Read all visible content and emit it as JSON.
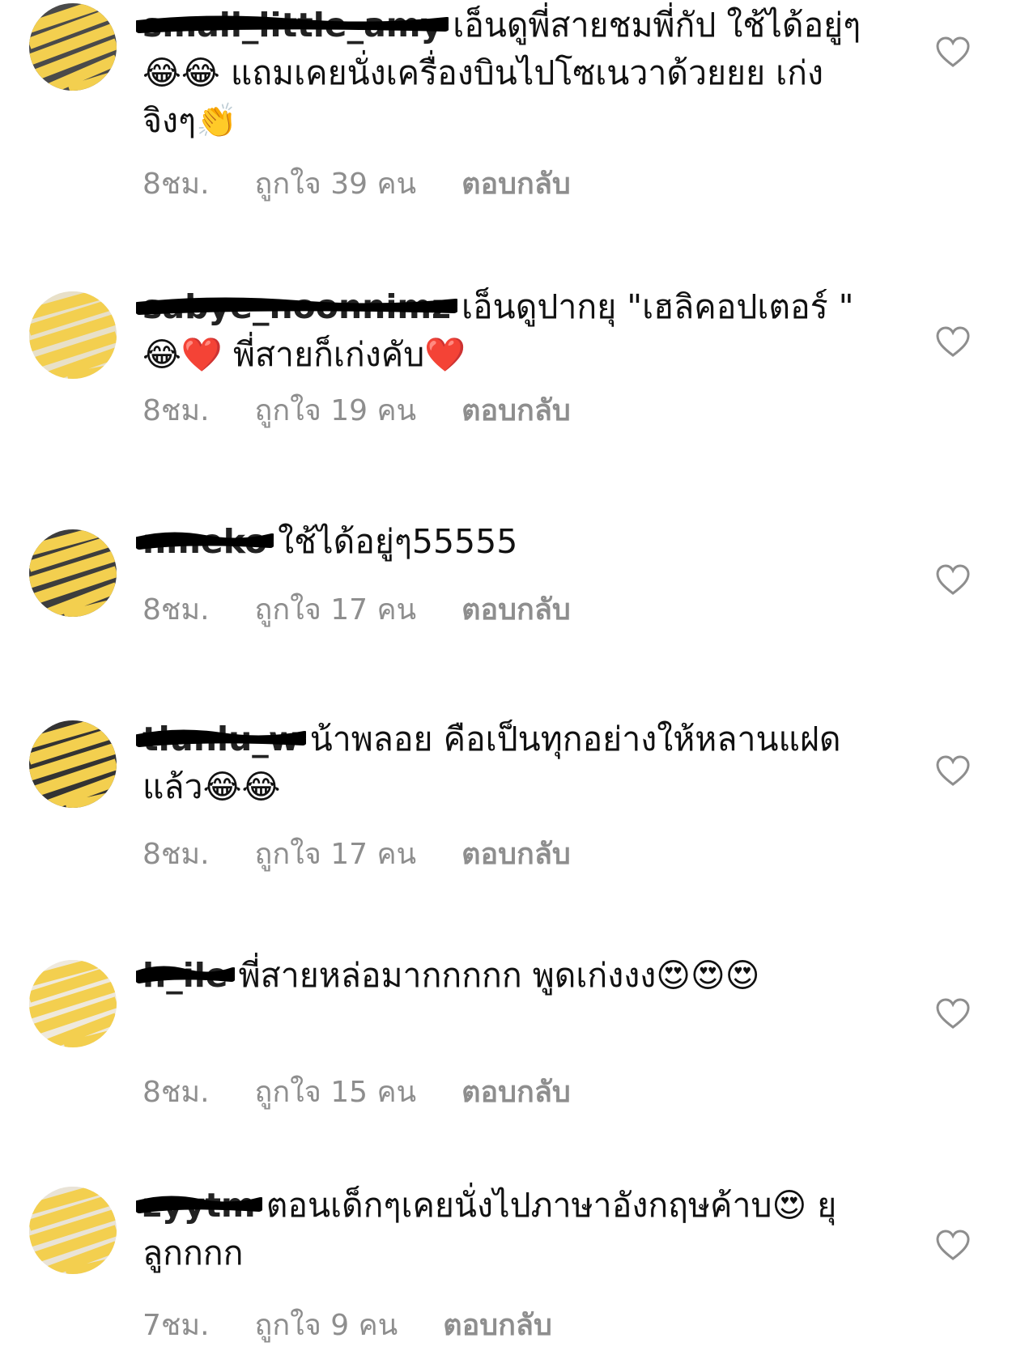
{
  "comments": [
    {
      "username": "small_little_amy",
      "text": "เอ็นดูพี่สายชมพี่กัป ใช้ได้อยู่ๆ 😂😂 แถมเคยนั่งเครื่องบินไปโซเนวาด้วยยย เก่งจิงๆ👏",
      "time": "8ชม.",
      "likes": "ถูกใจ 39 คน",
      "reply": "ตอบกลับ"
    },
    {
      "username": "sabye_noonnimz",
      "text": "เอ็นดูปากยุ \"เฮลิคอปเตอร์ \" 😂❤️ พี่สายก็เก่งคับ❤️",
      "time": "8ชม.",
      "likes": "ถูกใจ 19 คน",
      "reply": "ตอบกลับ"
    },
    {
      "username": "nmeko",
      "text": "ใช้ได้อยู่ๆ55555",
      "time": "8ชม.",
      "likes": "ถูกใจ 17 คน",
      "reply": "ตอบกลับ"
    },
    {
      "username": "tlunlu_w",
      "text": "น้าพลอย คือเป็นทุกอย่างให้หลานแฝดแล้ว😂😂",
      "time": "8ชม.",
      "likes": "ถูกใจ 17 คน",
      "reply": "ตอบกลับ"
    },
    {
      "username": "h_ile",
      "text": "พี่สายหล่อมากกกกก พูดเก่งงง😍😍😍",
      "time": "8ชม.",
      "likes": "ถูกใจ 15 คน",
      "reply": "ตอบกลับ"
    },
    {
      "username": "zyytm",
      "text": "ตอนเด็กๆเคยนั่งไปภาษาอังกฤษค้าบ😍 ยุลูกกกก",
      "time": "7ชม.",
      "likes": "ถูกใจ 9 คน",
      "reply": "ตอบกลับ"
    }
  ],
  "icons": {
    "like": "heart-outline-icon"
  },
  "colors": {
    "text": "#111111",
    "meta": "#8e8e8e",
    "scribble_yellow": "#f3cf4f",
    "redaction": "#000000"
  }
}
